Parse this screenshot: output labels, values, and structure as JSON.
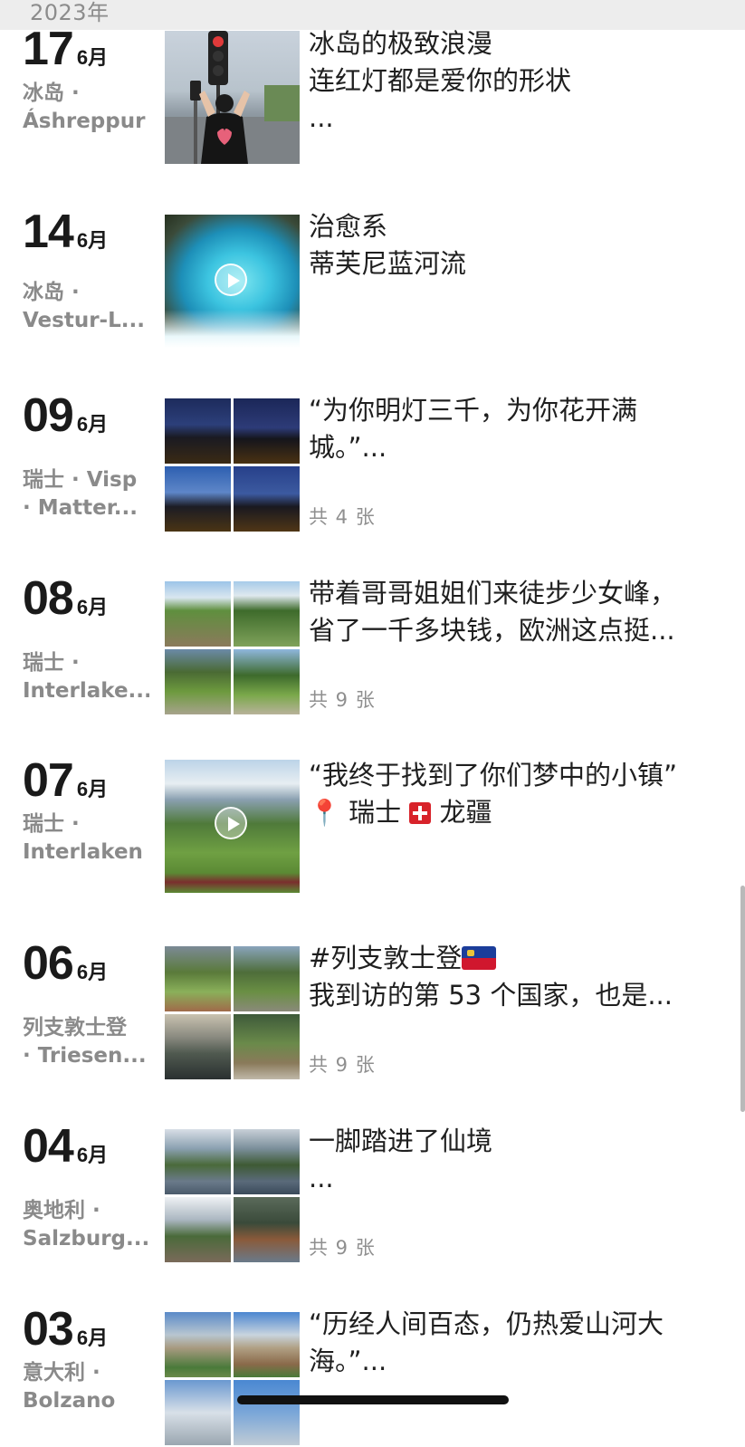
{
  "header": {
    "year": "2023年"
  },
  "posts": [
    {
      "day": "17",
      "month": "6月",
      "loc1": "冰岛 ·",
      "loc2": "Áshreppur",
      "lines": [
        "冰岛的极致浪漫",
        "连红灯都是爱你的形状",
        "..."
      ],
      "count": "",
      "video": false
    },
    {
      "day": "14",
      "month": "6月",
      "loc1": "冰岛 ·",
      "loc2": "Vestur-L...",
      "lines": [
        "治愈系",
        "蒂芙尼蓝河流"
      ],
      "count": "",
      "video": true
    },
    {
      "day": "09",
      "month": "6月",
      "loc1": "瑞士 · Visp",
      "loc2": "· Matter...",
      "lines": [
        "“为你明灯三千，为你花开满",
        "城。”..."
      ],
      "count": "共 4 张",
      "video": false
    },
    {
      "day": "08",
      "month": "6月",
      "loc1": "瑞士 ·",
      "loc2": "Interlake...",
      "lines": [
        "带着哥哥姐姐们来徒步少女峰，",
        "省了一千多块钱，欧洲这点挺..."
      ],
      "count": "共 9 张",
      "video": false
    },
    {
      "day": "07",
      "month": "6月",
      "loc1": "瑞士 ·",
      "loc2": "Interlaken",
      "lines": [
        "“我终于找到了你们梦中的小镇”",
        ""
      ],
      "loc_line": {
        "country": "瑞士",
        "town": "龙疆"
      },
      "count": "",
      "video": true
    },
    {
      "day": "06",
      "month": "6月",
      "loc1": "列支敦士登",
      "loc2": "· Triesen...",
      "lines": [
        "#列支敦士登",
        "我到访的第 53 个国家，也是..."
      ],
      "count": "共 9 张",
      "video": false
    },
    {
      "day": "04",
      "month": "6月",
      "loc1": "奥地利 ·",
      "loc2": "Salzburg...",
      "lines": [
        "一脚踏进了仙境",
        "..."
      ],
      "count": "共 9 张",
      "video": false
    },
    {
      "day": "03",
      "month": "6月",
      "loc1": "意大利 ·",
      "loc2": "Bolzano",
      "lines": [
        "“历经人间百态，仍热爱山河大",
        "海。”..."
      ],
      "count": "",
      "video": false
    }
  ],
  "colors": {
    "year_bar": "#ededed",
    "secondary_text": "#8a8a8a"
  }
}
